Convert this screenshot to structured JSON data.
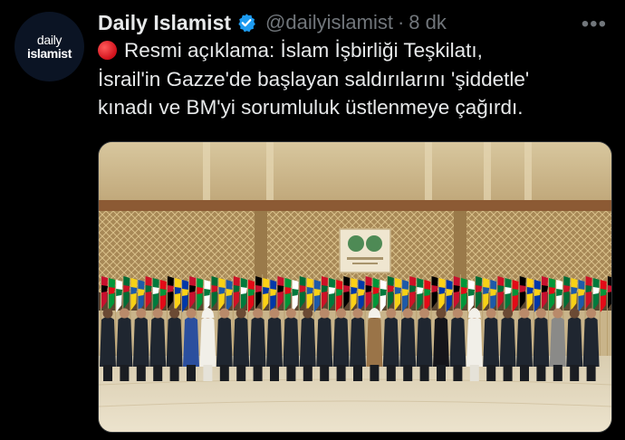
{
  "account": {
    "avatar_line1": "daily",
    "avatar_line2": "islamist",
    "display_name": "Daily Islamist",
    "handle": "@dailyislamist",
    "separator": "·",
    "time": "8 dk",
    "verified": true
  },
  "tweet": {
    "line1": "Resmi açıklama: İslam İşbirliği Teşkilatı,",
    "line2": "İsrail'in Gazze'de başlayan saldırılarını 'şiddetle'",
    "line3": "kınadı ve BM'yi sorumluluk üstlenmeye çağırdı.",
    "emoji": "red-circle"
  },
  "media": {
    "kind": "photo",
    "subject": "group photo of delegates in front of flags in a conference hall"
  },
  "icons": {
    "verified": "verified-badge-icon",
    "more": "more-options-icon"
  },
  "colors": {
    "background": "#000000",
    "text": "#e7e9ea",
    "muted": "#71767b",
    "verified": "#1d9bf0"
  }
}
